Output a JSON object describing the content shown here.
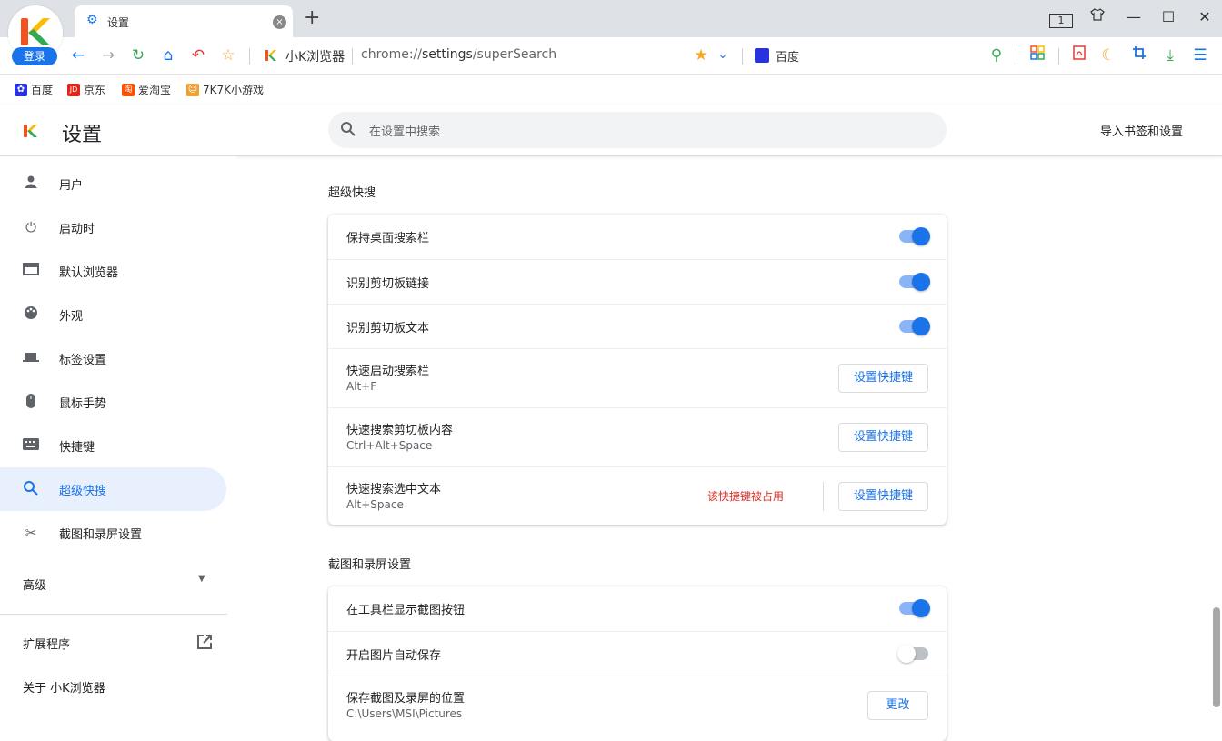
{
  "browser": {
    "login_label": "登录",
    "tab_title": "设置",
    "tab_close": "×",
    "new_tab": "+",
    "tab_count": "1",
    "site_name": "小K浏览器",
    "url_prefix": "chrome://",
    "url_path": "settings",
    "url_rest": "/superSearch",
    "search_engine": "百度",
    "accent": "#1a73e8"
  },
  "bookmarks": [
    {
      "label": "百度",
      "icon": "baidu-paw-icon"
    },
    {
      "label": "京东",
      "icon": "jd-icon",
      "badge": "JD"
    },
    {
      "label": "爱淘宝",
      "icon": "aitaobao-icon",
      "badge": "淘"
    },
    {
      "label": "7K7K小游戏",
      "icon": "7k7k-icon"
    }
  ],
  "header": {
    "title": "设置",
    "search_placeholder": "在设置中搜索",
    "import_label": "导入书签和设置"
  },
  "sidebar": {
    "items": [
      {
        "label": "用户",
        "icon": "person-icon"
      },
      {
        "label": "启动时",
        "icon": "power-icon"
      },
      {
        "label": "默认浏览器",
        "icon": "browser-window-icon"
      },
      {
        "label": "外观",
        "icon": "palette-icon"
      },
      {
        "label": "标签设置",
        "icon": "tab-icon"
      },
      {
        "label": "鼠标手势",
        "icon": "mouse-icon"
      },
      {
        "label": "快捷键",
        "icon": "keyboard-icon"
      },
      {
        "label": "超级快搜",
        "icon": "search-icon",
        "active": true
      },
      {
        "label": "截图和录屏设置",
        "icon": "scissors-icon"
      }
    ],
    "advanced_label": "高级",
    "extensions_label": "扩展程序",
    "about_label": "关于 小K浏览器"
  },
  "super_search": {
    "title": "超级快搜",
    "rows": [
      {
        "label": "保持桌面搜索栏",
        "toggle": true
      },
      {
        "label": "识别剪切板链接",
        "toggle": true
      },
      {
        "label": "识别剪切板文本",
        "toggle": true
      },
      {
        "label": "快速启动搜索栏",
        "shortcut": "Alt+F",
        "button": "设置快捷键"
      },
      {
        "label": "快速搜索剪切板内容",
        "shortcut": "Ctrl+Alt+Space",
        "button": "设置快捷键"
      },
      {
        "label": "快速搜索选中文本",
        "shortcut": "Alt+Space",
        "button": "设置快捷键",
        "warning": "该快捷键被占用"
      }
    ]
  },
  "screenshot": {
    "title": "截图和录屏设置",
    "rows": [
      {
        "label": "在工具栏显示截图按钮",
        "toggle": true
      },
      {
        "label": "开启图片自动保存",
        "toggle": false
      },
      {
        "label": "保存截图及录屏的位置",
        "path": "C:\\Users\\MSI\\Pictures",
        "button": "更改"
      }
    ]
  }
}
